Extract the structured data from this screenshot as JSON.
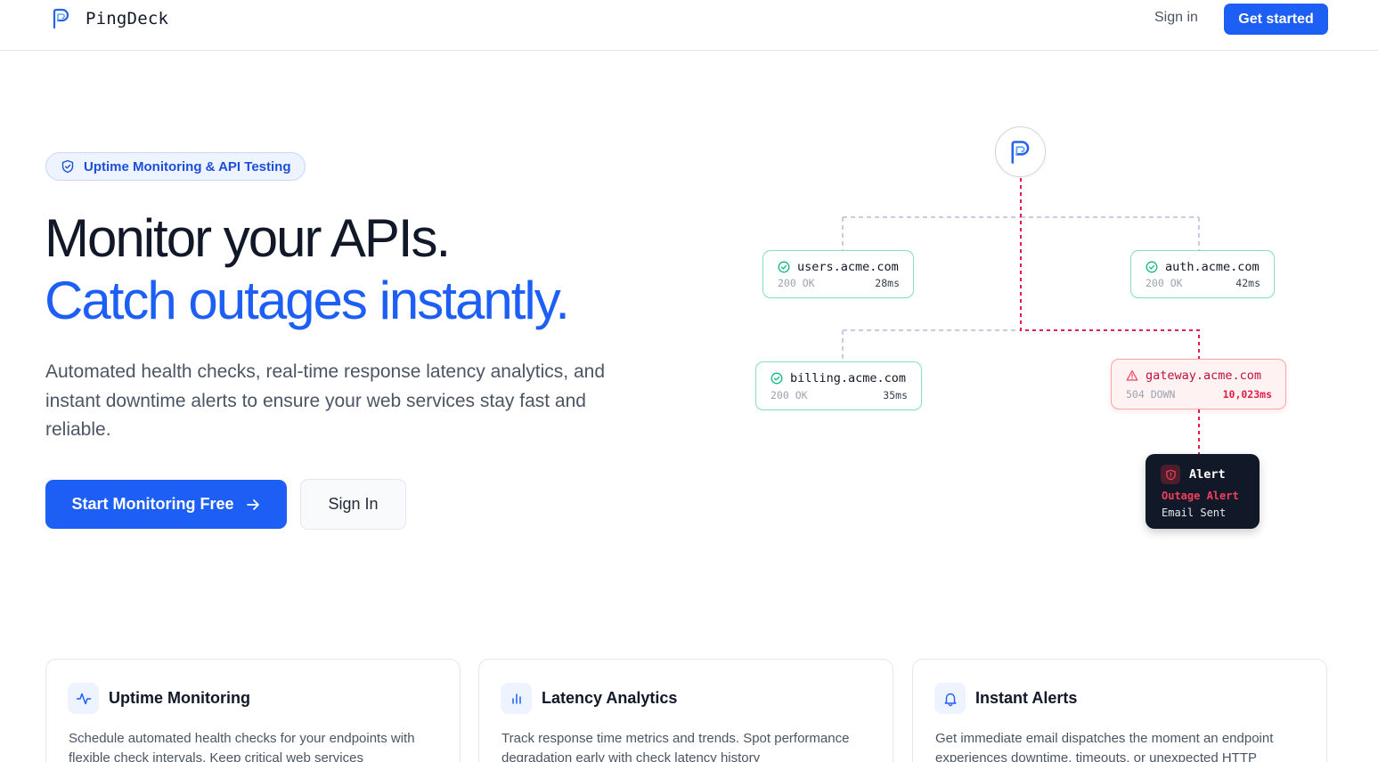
{
  "header": {
    "brand": "PingDeck",
    "sign_in": "Sign in",
    "get_started": "Get started"
  },
  "hero": {
    "badge": "Uptime Monitoring & API Testing",
    "headline_1": "Monitor your APIs.",
    "headline_2": "Catch outages instantly.",
    "lead": "Automated health checks, real-time response latency analytics, and instant downtime alerts to ensure your web services stay fast and reliable.",
    "cta_primary": "Start Monitoring Free",
    "cta_secondary": "Sign In"
  },
  "diagram": {
    "nodes": [
      {
        "host": "users.acme.com",
        "status": "200 OK",
        "latency": "28ms",
        "state": "up"
      },
      {
        "host": "auth.acme.com",
        "status": "200 OK",
        "latency": "42ms",
        "state": "up"
      },
      {
        "host": "billing.acme.com",
        "status": "200 OK",
        "latency": "35ms",
        "state": "up"
      },
      {
        "host": "gateway.acme.com",
        "status": "504 DOWN",
        "latency": "10,023ms",
        "state": "down"
      }
    ],
    "alert": {
      "title": "Alert",
      "line_1": "Outage Alert",
      "line_2": "Email Sent"
    }
  },
  "features": [
    {
      "title": "Uptime Monitoring",
      "icon": "activity-icon",
      "body": "Schedule automated health checks for your endpoints with flexible check intervals. Keep critical web services"
    },
    {
      "title": "Latency Analytics",
      "icon": "bar-chart-icon",
      "body": "Track response time metrics and trends. Spot performance degradation early with check latency history"
    },
    {
      "title": "Instant Alerts",
      "icon": "bell-icon",
      "body": "Get immediate email dispatches the moment an endpoint experiences downtime, timeouts, or unexpected HTTP"
    }
  ],
  "colors": {
    "brand_blue": "#1d5ff5",
    "success_green": "#10b981",
    "danger_red": "#e11d48",
    "text_dark": "#111827",
    "text_muted": "#4b5563"
  }
}
